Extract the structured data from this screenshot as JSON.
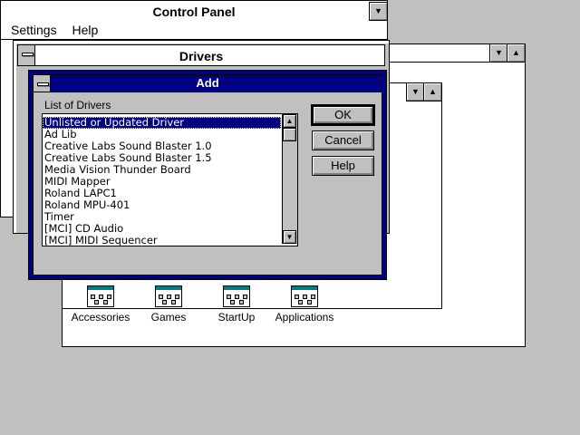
{
  "control_panel": {
    "title": "Control Panel",
    "menu": [
      "Settings",
      "Help"
    ]
  },
  "drivers": {
    "title": "Drivers"
  },
  "program_manager": {
    "groups": [
      {
        "label": "Accessories",
        "icon": "program-group-icon"
      },
      {
        "label": "Games",
        "icon": "program-group-icon"
      },
      {
        "label": "StartUp",
        "icon": "program-group-icon"
      },
      {
        "label": "Applications",
        "icon": "program-group-icon"
      }
    ]
  },
  "add_dialog": {
    "title": "Add",
    "list_label": "List of Drivers",
    "items": [
      "Unlisted or Updated Driver",
      "Ad Lib",
      "Creative Labs Sound Blaster 1.0",
      "Creative Labs Sound Blaster 1.5",
      "Media Vision Thunder Board",
      "MIDI Mapper",
      "Roland LAPC1",
      "Roland MPU-401",
      "Timer",
      "[MCI] CD Audio",
      "[MCI] MIDI Sequencer"
    ],
    "selected_index": 0,
    "buttons": {
      "ok": "OK",
      "cancel": "Cancel",
      "help": "Help"
    }
  },
  "colors": {
    "desktop": "#c0c0c0",
    "active_title": "#000080",
    "selection": "#000080"
  }
}
